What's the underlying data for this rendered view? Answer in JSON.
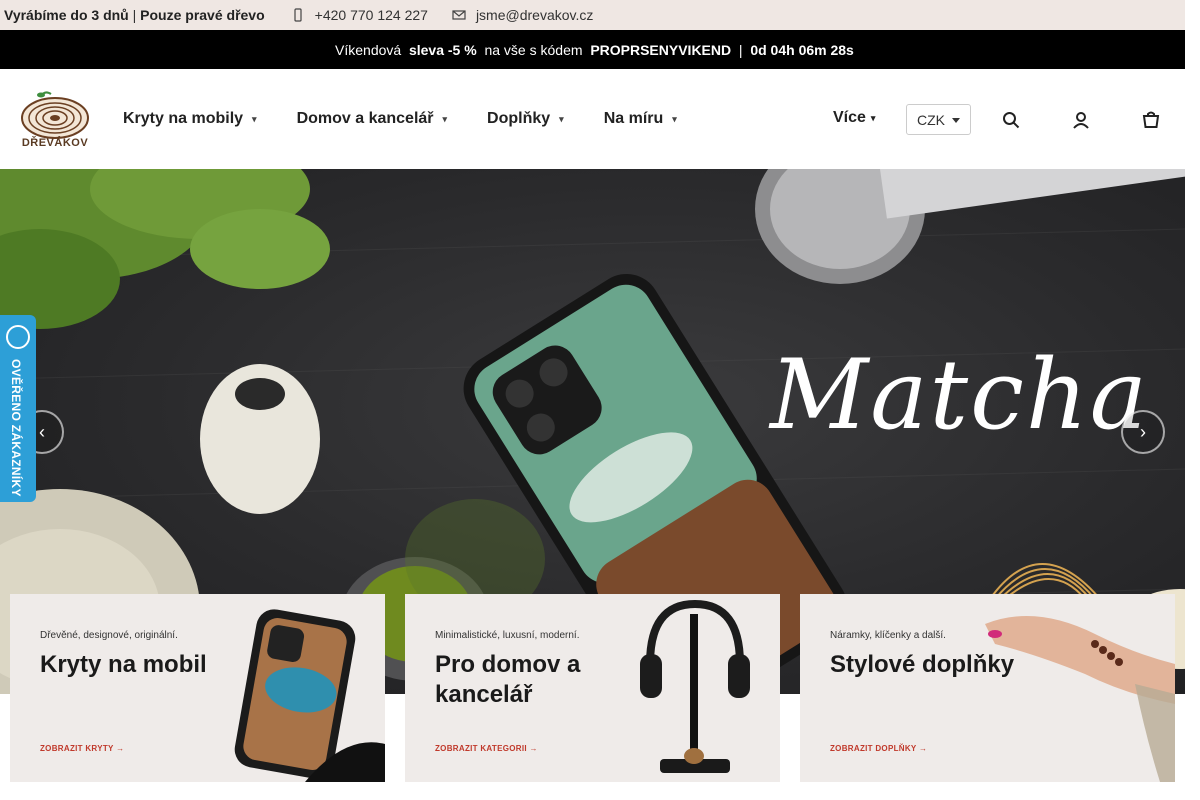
{
  "topbar": {
    "claim_part1": "Vyrábíme do 3 dnů",
    "separator": "|",
    "claim_part2": "Pouze pravé dřevo",
    "phone": "+420 770 124 227",
    "email": "jsme@drevakov.cz",
    "phone_icon": "phone-icon",
    "email_icon": "envelope-icon"
  },
  "promo": {
    "prefix": " Víkendová ",
    "discount": "sleva -5 %",
    "middle": "na vše s kódem",
    "code": "PROPRSENYVIKEND",
    "divider": "|",
    "countdown": "0d 04h 06m 28s"
  },
  "header": {
    "logo_text": "DŘEVÁKOV",
    "nav": [
      {
        "label": "Kryty na mobily"
      },
      {
        "label": "Domov a kancelář"
      },
      {
        "label": "Doplňky"
      },
      {
        "label": "Na míru"
      }
    ],
    "more_label": "Více",
    "currency": "CZK",
    "icons": [
      "search-icon",
      "user-icon",
      "cart-icon"
    ]
  },
  "hero": {
    "title": "Matcha",
    "prev_icon": "chevron-left-icon",
    "next_icon": "chevron-right-icon"
  },
  "badge": {
    "text": "OVĚŘENO ZÁKAZNÍKY"
  },
  "cards": [
    {
      "subtitle": "Dřevěné, designové, originální.",
      "title": "Kryty na mobil",
      "cta": "ZOBRAZIT KRYTY"
    },
    {
      "subtitle": "Minimalistické, luxusní, moderní.",
      "title": "Pro domov a kancelář",
      "cta": "ZOBRAZIT KATEGORII"
    },
    {
      "subtitle": "Náramky, klíčenky a další.",
      "title": "Stylové doplňky",
      "cta": "ZOBRAZIT DOPLŇKY"
    }
  ],
  "colors": {
    "topbar_bg": "#efe7e3",
    "promo_bg": "#000000",
    "badge_bg": "#2d9fd7",
    "card_bg": "#efebe9",
    "cta_red": "#c0392b"
  }
}
